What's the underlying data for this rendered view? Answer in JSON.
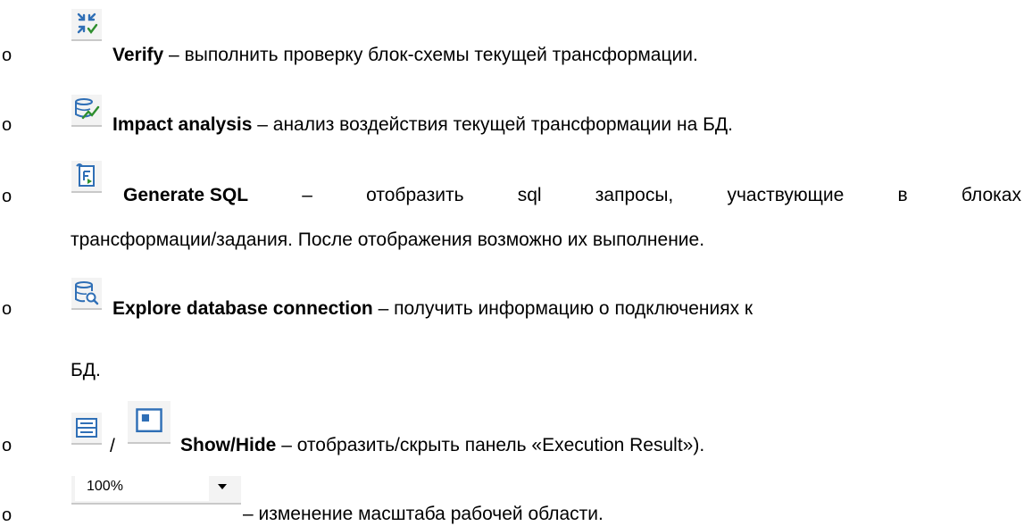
{
  "items": [
    {
      "term": "Verify",
      "desc": " – выполнить проверку блок-схемы текущей трансформации.",
      "icon": "verify-icon"
    },
    {
      "term": "Impact analysis",
      "desc": " – анализ воздействия текущей трансформации на БД.",
      "icon": "impact-analysis-icon"
    },
    {
      "term": "Generate SQL",
      "line1_words": [
        "–",
        "отобразить",
        "sql",
        "запросы,",
        "участвующие",
        "в",
        "блоках"
      ],
      "line2": "трансформации/задания. После отображения возможно их выполнение.",
      "icon": "generate-sql-icon"
    },
    {
      "term": "Explore database connection",
      "desc": " – получить информацию о подключениях к",
      "line2": "БД.",
      "icon": "explore-database-icon"
    },
    {
      "term_show": "Show",
      "separator": "/",
      "term_hide": "Hide",
      "desc": " – отобразить/скрыть панель «Execution Result»).",
      "icons": [
        "show-panel-icon",
        "hide-panel-icon"
      ]
    },
    {
      "zoom_value": "100%",
      "desc": " – изменение масштаба рабочей области.",
      "icon": "dropdown-arrow-icon"
    }
  ],
  "bullet": "o"
}
